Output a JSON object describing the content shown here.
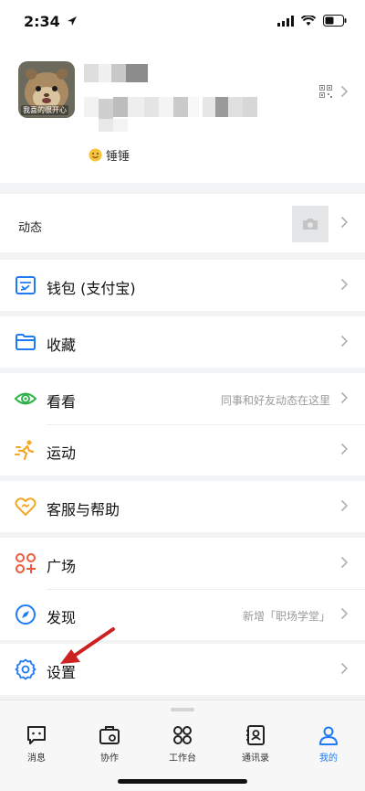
{
  "status_bar": {
    "time": "2:34"
  },
  "profile": {
    "avatar_caption": "我喜的很开心",
    "status_text": "锤锤"
  },
  "moments": {
    "label": "动态"
  },
  "menu": [
    {
      "id": "wallet",
      "label": "钱包 (支付宝)",
      "icon": "wallet-icon",
      "color": "#1f7bf5",
      "hint": ""
    },
    {
      "id": "favorites",
      "label": "收藏",
      "icon": "folder-icon",
      "color": "#1f7bf5",
      "hint": ""
    },
    {
      "id": "watch",
      "label": "看看",
      "icon": "eye-icon",
      "color": "#2fb34a",
      "hint": "同事和好友动态在这里"
    },
    {
      "id": "sport",
      "label": "运动",
      "icon": "running-icon",
      "color": "#f5a623",
      "hint": ""
    },
    {
      "id": "help",
      "label": "客服与帮助",
      "icon": "heart-icon",
      "color": "#f5a623",
      "hint": ""
    },
    {
      "id": "plaza",
      "label": "广场",
      "icon": "apps-plus-icon",
      "color": "#f05a3c",
      "hint": ""
    },
    {
      "id": "discover",
      "label": "发现",
      "icon": "compass-icon",
      "color": "#1f7bf5",
      "hint": "新增「职场学堂」"
    },
    {
      "id": "settings",
      "label": "设置",
      "icon": "gear-icon",
      "color": "#1f7bf5",
      "hint": ""
    }
  ],
  "tabbar": [
    {
      "label": "消息",
      "icon": "message-icon",
      "active": false
    },
    {
      "label": "协作",
      "icon": "briefcase-icon",
      "active": false
    },
    {
      "label": "工作台",
      "icon": "grid-icon",
      "active": false
    },
    {
      "label": "通讯录",
      "icon": "contacts-icon",
      "active": false
    },
    {
      "label": "我的",
      "icon": "person-icon",
      "active": true
    }
  ],
  "colors": {
    "accent": "#1f7bf5",
    "annotation_arrow": "#cc2222"
  }
}
